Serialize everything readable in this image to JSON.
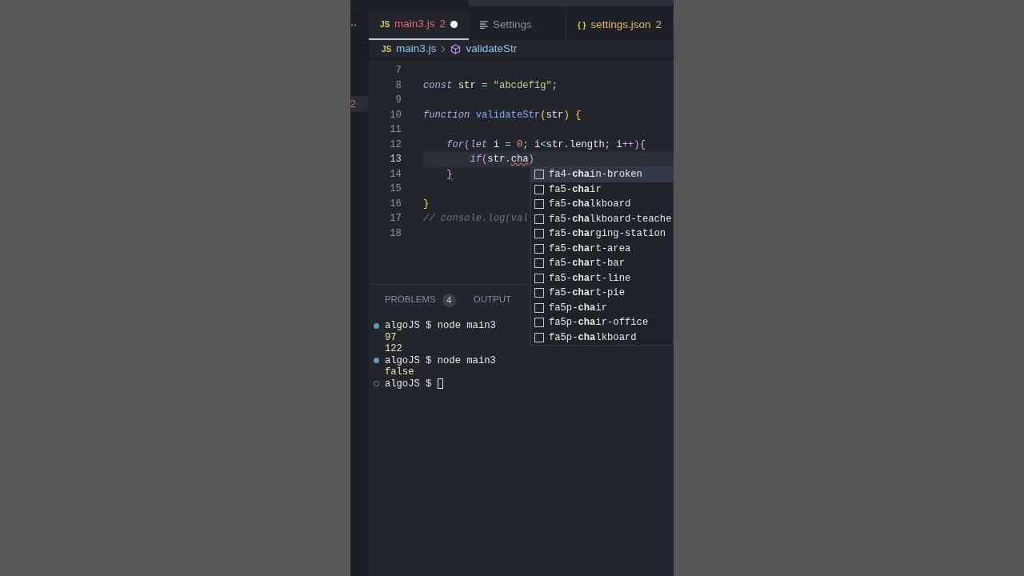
{
  "side_strip": {
    "badge": "2"
  },
  "tabs": [
    {
      "kind": "text_icon",
      "icon_text": "JS",
      "label": "main3.js",
      "badge": "2",
      "selected": true,
      "modified": true,
      "color": "#e0666e"
    },
    {
      "kind": "lines_icon",
      "label": "Settings",
      "selected": false,
      "modified": false,
      "color": "#8a8f98"
    },
    {
      "kind": "text_icon",
      "icon_text": "{ }",
      "label": "settings.json",
      "badge": "2",
      "selected": false,
      "modified": false,
      "color": "#e8b66c"
    }
  ],
  "breadcrumb": {
    "file_icon": "JS",
    "file": "main3.js",
    "symbol": "validateStr"
  },
  "code_lines": [
    {
      "number": "7",
      "current": false
    },
    {
      "number": "8",
      "current": false,
      "tokens": [
        {
          "kind": "keyword",
          "text": "const "
        },
        {
          "kind": "ident",
          "text": "str "
        },
        {
          "kind": "punct",
          "text": "= "
        },
        {
          "kind": "string",
          "text": "\"abcdef1g\""
        },
        {
          "kind": "punct",
          "text": ";"
        }
      ]
    },
    {
      "number": "9",
      "current": false
    },
    {
      "number": "10",
      "current": false,
      "tokens": [
        {
          "kind": "keyword",
          "text": "function "
        },
        {
          "kind": "func",
          "text": "validateStr"
        },
        {
          "kind": "brace",
          "text": "("
        },
        {
          "kind": "ident",
          "text": "str"
        },
        {
          "kind": "brace",
          "text": ") {"
        }
      ]
    },
    {
      "number": "11",
      "current": false
    },
    {
      "number": "12",
      "current": false,
      "tokens": [
        {
          "kind": "keyword",
          "text": "    for"
        },
        {
          "kind": "paren",
          "text": "("
        },
        {
          "kind": "keyword",
          "text": "let "
        },
        {
          "kind": "ident",
          "text": "i "
        },
        {
          "kind": "punct",
          "text": "= "
        },
        {
          "kind": "number",
          "text": "0"
        },
        {
          "kind": "punct",
          "text": "; "
        },
        {
          "kind": "ident",
          "text": "i"
        },
        {
          "kind": "punct",
          "text": "<"
        },
        {
          "kind": "ident",
          "text": "str"
        },
        {
          "kind": "punct",
          "text": "."
        },
        {
          "kind": "ident",
          "text": "length"
        },
        {
          "kind": "punct",
          "text": "; "
        },
        {
          "kind": "ident",
          "text": "i"
        },
        {
          "kind": "paren",
          "text": "++){"
        }
      ]
    },
    {
      "number": "13",
      "current": true,
      "tokens": [
        {
          "kind": "keyword",
          "text": "        if"
        },
        {
          "kind": "paren",
          "text": "("
        },
        {
          "kind": "ident",
          "text": "str"
        },
        {
          "kind": "punct",
          "text": "."
        },
        {
          "kind": "ident",
          "text": "cha",
          "error": true
        },
        {
          "kind": "paren",
          "text": ")"
        }
      ]
    },
    {
      "number": "14",
      "current": false,
      "tokens": [
        {
          "kind": "paren",
          "text": "    }",
          "error": true
        }
      ]
    },
    {
      "number": "15",
      "current": false
    },
    {
      "number": "16",
      "current": false,
      "tokens": [
        {
          "kind": "brace",
          "text": "}"
        }
      ]
    },
    {
      "number": "17",
      "current": false,
      "tokens": [
        {
          "kind": "comment",
          "text": "// console.log(val"
        }
      ]
    },
    {
      "number": "18",
      "current": false
    }
  ],
  "suggestions": [
    {
      "label": "fa4-**cha**in-broken",
      "selected": true
    },
    {
      "label": "fa5-**cha**ir",
      "selected": false
    },
    {
      "label": "fa5-**cha**lkboard",
      "selected": false
    },
    {
      "label": "fa5-**cha**lkboard-teache",
      "selected": false
    },
    {
      "label": "fa5-**cha**rging-station",
      "selected": false
    },
    {
      "label": "fa5-**cha**rt-area",
      "selected": false
    },
    {
      "label": "fa5-**cha**rt-bar",
      "selected": false
    },
    {
      "label": "fa5-**cha**rt-line",
      "selected": false
    },
    {
      "label": "fa5-**cha**rt-pie",
      "selected": false
    },
    {
      "label": "fa5p-**cha**ir",
      "selected": false
    },
    {
      "label": "fa5p-**cha**ir-office",
      "selected": false
    },
    {
      "label": "fa5p-**cha**lkboard",
      "selected": false
    }
  ],
  "panel_tabs": [
    {
      "label": "PROBLEMS",
      "count": "4"
    },
    {
      "label": "OUTPUT"
    }
  ],
  "terminal": [
    {
      "kind": "prompt",
      "done": true,
      "text": "algoJS $ node main3"
    },
    {
      "kind": "output",
      "text": "97"
    },
    {
      "kind": "output",
      "text": "122"
    },
    {
      "kind": "prompt",
      "done": true,
      "text": "algoJS $ node main3"
    },
    {
      "kind": "output",
      "text": "false"
    },
    {
      "kind": "prompt",
      "done": false,
      "text": "algoJS $ ",
      "cursor": true
    }
  ]
}
